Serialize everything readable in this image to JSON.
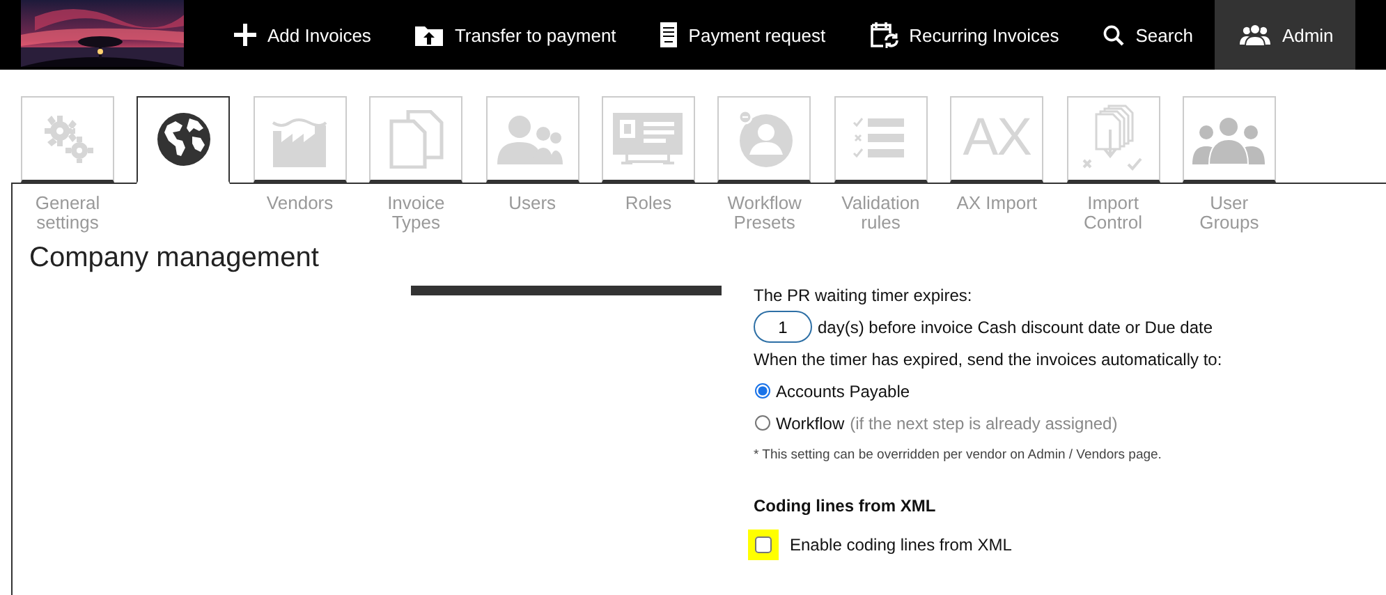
{
  "nav": {
    "items": [
      {
        "label": "Add Invoices",
        "selected": false
      },
      {
        "label": "Transfer to payment",
        "selected": false
      },
      {
        "label": "Payment request",
        "selected": false
      },
      {
        "label": "Recurring Invoices",
        "selected": false
      },
      {
        "label": "Search",
        "selected": false
      },
      {
        "label": "Admin",
        "selected": true
      }
    ]
  },
  "tabs": [
    {
      "label": "General settings",
      "selected": false
    },
    {
      "selected": true
    },
    {
      "label": "Vendors",
      "selected": false
    },
    {
      "label": "Invoice Types",
      "selected": false
    },
    {
      "label": "Users",
      "selected": false
    },
    {
      "label": "Roles",
      "selected": false
    },
    {
      "label": "Workflow Presets",
      "selected": false
    },
    {
      "label": "Validation rules",
      "selected": false
    },
    {
      "label": "AX Import",
      "glyph": "AX",
      "selected": false
    },
    {
      "label": "Import Control",
      "selected": false
    },
    {
      "label": "User Groups",
      "selected": false
    }
  ],
  "page_title": "Company management",
  "pr_timer": {
    "label": "The PR waiting timer expires:",
    "days": {
      "value": "1"
    },
    "days_suffix": "day(s) before invoice Cash discount date or Due date",
    "send_label": "When the timer has expired, send the invoices automatically to:",
    "options": [
      {
        "label": "Accounts Payable",
        "selected": true
      },
      {
        "label": "Workflow",
        "hint": "(if the next step is already assigned)",
        "selected": false
      }
    ],
    "note": "* This setting can be overridden per vendor on Admin / Vendors page."
  },
  "coding_lines": {
    "title": "Coding lines from XML",
    "checkbox": {
      "label": "Enable coding lines from XML",
      "checked": false,
      "highlighted": true
    }
  }
}
